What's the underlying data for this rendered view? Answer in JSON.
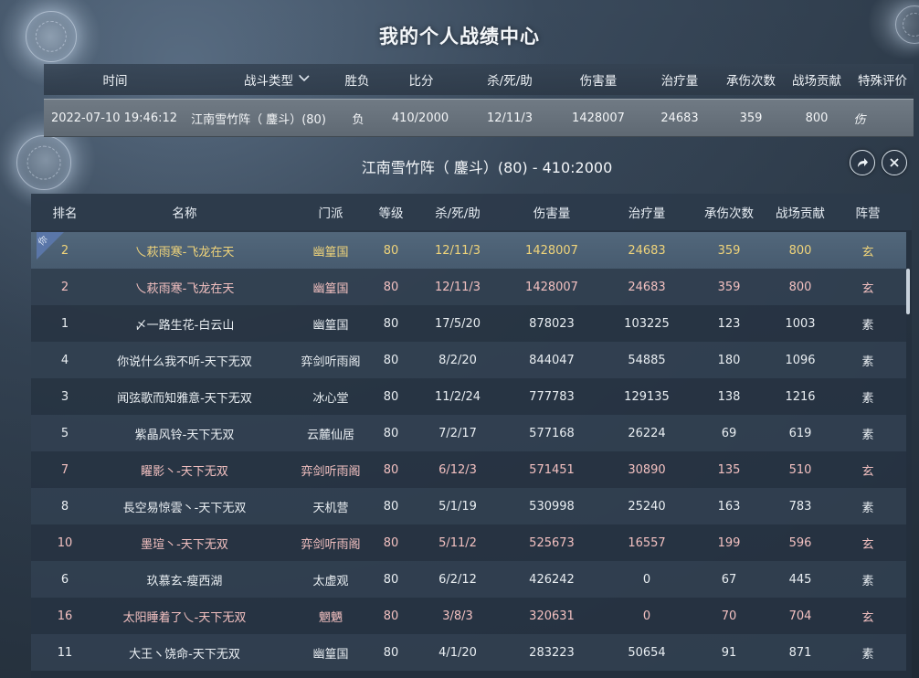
{
  "window_title": "我的个人战绩中心",
  "summary": {
    "headers": [
      "时间",
      "战斗类型",
      "胜负",
      "比分",
      "杀/死/助",
      "伤害量",
      "治疗量",
      "承伤次数",
      "战场贡献",
      "特殊评价"
    ],
    "row": [
      "2022-07-10 19:46:12",
      "江南雪竹阵（ 鏖斗）(80)",
      "负",
      "410/2000",
      "12/11/3",
      "1428007",
      "24683",
      "359",
      "800",
      "伤"
    ]
  },
  "match_title": "江南雪竹阵（ 鏖斗）(80) - 410:2000",
  "buttons": {
    "share_icon": "share-arrow-icon",
    "close_icon": "close-icon"
  },
  "table": {
    "headers": [
      "排名",
      "名称",
      "门派",
      "等级",
      "杀/死/助",
      "伤害量",
      "治疗量",
      "承伤次数",
      "战场贡献",
      "阵营"
    ],
    "self_badge": "你",
    "rows": [
      {
        "rank": "2",
        "name": "乀萩雨寒-飞龙在天",
        "school": "幽篁国",
        "level": "80",
        "kda": "12/11/3",
        "damage": "1428007",
        "heal": "24683",
        "hits": "359",
        "contrib": "800",
        "camp": "玄"
      },
      {
        "rank": "2",
        "name": "乀萩雨寒-飞龙在天",
        "school": "幽篁国",
        "level": "80",
        "kda": "12/11/3",
        "damage": "1428007",
        "heal": "24683",
        "hits": "359",
        "contrib": "800",
        "camp": "玄"
      },
      {
        "rank": "1",
        "name": "〆一路生花-白云山",
        "school": "幽篁国",
        "level": "80",
        "kda": "17/5/20",
        "damage": "878023",
        "heal": "103225",
        "hits": "123",
        "contrib": "1003",
        "camp": "素"
      },
      {
        "rank": "4",
        "name": "你说什么我不听-天下无双",
        "school": "弈剑听雨阁",
        "level": "80",
        "kda": "8/2/20",
        "damage": "844047",
        "heal": "54885",
        "hits": "180",
        "contrib": "1096",
        "camp": "素"
      },
      {
        "rank": "3",
        "name": "闻弦歌而知雅意-天下无双",
        "school": "冰心堂",
        "level": "80",
        "kda": "11/2/24",
        "damage": "777783",
        "heal": "129135",
        "hits": "138",
        "contrib": "1216",
        "camp": "素"
      },
      {
        "rank": "5",
        "name": "紫晶风铃-天下无双",
        "school": "云麓仙居",
        "level": "80",
        "kda": "7/2/17",
        "damage": "577168",
        "heal": "26224",
        "hits": "69",
        "contrib": "619",
        "camp": "素"
      },
      {
        "rank": "7",
        "name": "矅影丶-天下无双",
        "school": "弈剑听雨阁",
        "level": "80",
        "kda": "6/12/3",
        "damage": "571451",
        "heal": "30890",
        "hits": "135",
        "contrib": "510",
        "camp": "玄"
      },
      {
        "rank": "8",
        "name": "長空易惊雲丶-天下无双",
        "school": "天机营",
        "level": "80",
        "kda": "5/1/19",
        "damage": "530998",
        "heal": "25240",
        "hits": "163",
        "contrib": "783",
        "camp": "素"
      },
      {
        "rank": "10",
        "name": "墨瑄丶-天下无双",
        "school": "弈剑听雨阁",
        "level": "80",
        "kda": "5/11/2",
        "damage": "525673",
        "heal": "16557",
        "hits": "199",
        "contrib": "596",
        "camp": "玄"
      },
      {
        "rank": "6",
        "name": "玖慕玄-瘦西湖",
        "school": "太虚观",
        "level": "80",
        "kda": "6/2/12",
        "damage": "426242",
        "heal": "0",
        "hits": "67",
        "contrib": "445",
        "camp": "素"
      },
      {
        "rank": "16",
        "name": "太阳睡着了乀-天下无双",
        "school": "魍魉",
        "level": "80",
        "kda": "3/8/3",
        "damage": "320631",
        "heal": "0",
        "hits": "70",
        "contrib": "704",
        "camp": "玄"
      },
      {
        "rank": "11",
        "name": "大王ヽ饶命-天下无双",
        "school": "幽篁国",
        "level": "80",
        "kda": "4/1/20",
        "damage": "283223",
        "heal": "50654",
        "hits": "91",
        "contrib": "871",
        "camp": "素"
      }
    ]
  },
  "colors": {
    "xuan": "#f2c0c0",
    "su": "#e9eef2",
    "self": "#f0d47a"
  }
}
